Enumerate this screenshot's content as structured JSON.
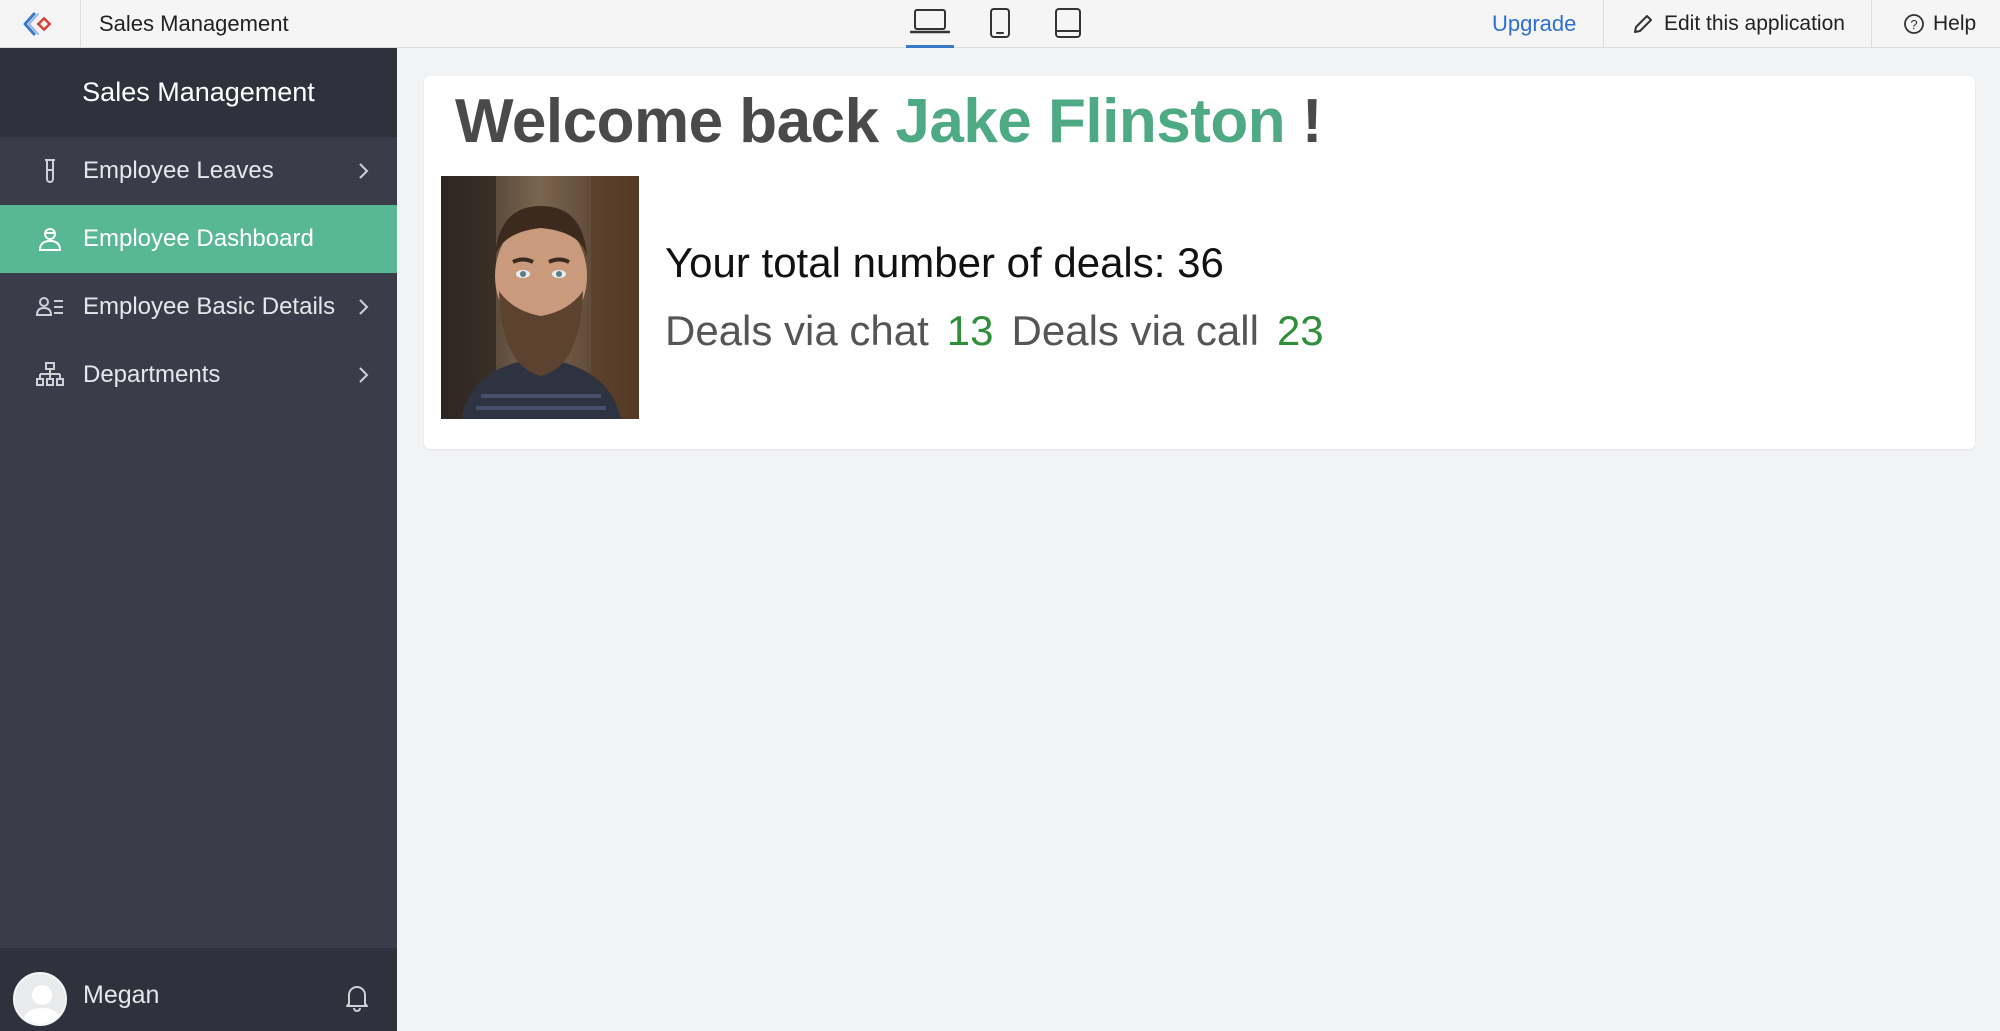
{
  "topbar": {
    "app_title": "Sales Management",
    "devices": [
      {
        "name": "laptop-icon",
        "active": true
      },
      {
        "name": "phone-icon",
        "active": false
      },
      {
        "name": "tablet-icon",
        "active": false
      }
    ],
    "upgrade_label": "Upgrade",
    "edit_label": "Edit this application",
    "help_label": "Help"
  },
  "sidebar": {
    "title": "Sales Management",
    "items": [
      {
        "label": "Employee Leaves",
        "icon": "test-tube-icon",
        "has_chevron": true,
        "active": false
      },
      {
        "label": "Employee Dashboard",
        "icon": "employee-icon",
        "has_chevron": false,
        "active": true
      },
      {
        "label": "Employee Basic Details",
        "icon": "person-list-icon",
        "has_chevron": true,
        "active": false
      },
      {
        "label": "Departments",
        "icon": "org-chart-icon",
        "has_chevron": true,
        "active": false
      }
    ],
    "user": {
      "name": "Megan"
    }
  },
  "main": {
    "welcome_prefix": "Welcome back",
    "employee_name": "Jake Flinston",
    "welcome_suffix": "!",
    "total_deals_label": "Your total number of deals: 36",
    "chat_label": "Deals via chat",
    "chat_count": "13",
    "call_label": "Deals via call",
    "call_count": "23"
  },
  "colors": {
    "accent": "#58b895",
    "sidebar_bg": "#3a3d49",
    "link": "#2f6fd0",
    "count_green": "#2f8f3a"
  }
}
